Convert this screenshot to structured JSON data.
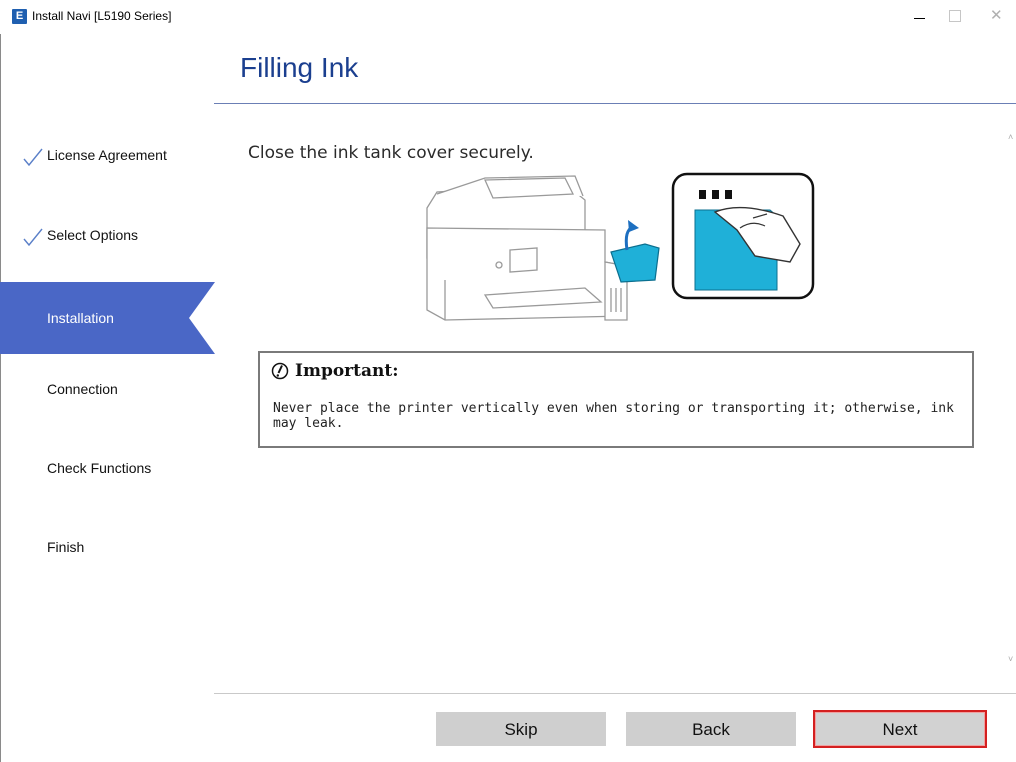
{
  "window": {
    "app_icon_letter": "E",
    "title": "Install Navi [L5190 Series]",
    "close_glyph": "✕"
  },
  "page": {
    "title": "Filling Ink"
  },
  "sidebar": {
    "items": [
      {
        "label": "License Agreement",
        "state": "completed",
        "icon": "check-icon"
      },
      {
        "label": "Select Options",
        "state": "completed",
        "icon": "check-icon"
      },
      {
        "label": "Installation",
        "state": "active"
      },
      {
        "label": "Connection",
        "state": "pending"
      },
      {
        "label": "Check Functions",
        "state": "pending"
      },
      {
        "label": "Finish",
        "state": "pending"
      }
    ]
  },
  "content": {
    "instruction": "Close the ink tank cover securely.",
    "illustration_icon": "printer-ink-tank-illustration",
    "important": {
      "icon": "important-icon",
      "title": "Important:",
      "text": "Never place the printer vertically even when storing or transporting it; otherwise, ink may leak."
    }
  },
  "footer": {
    "skip_label": "Skip",
    "back_label": "Back",
    "next_label": "Next"
  },
  "colors": {
    "accent": "#4a67c6",
    "title": "#1b3f8f",
    "button": "#cfcfcf",
    "highlight": "#d42020",
    "ink_cyan": "#1fb0d8"
  }
}
